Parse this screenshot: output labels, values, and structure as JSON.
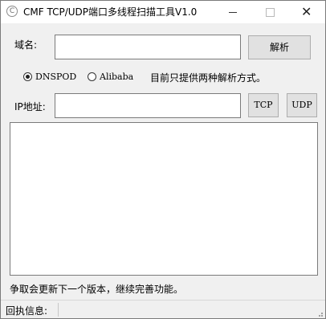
{
  "window": {
    "title": "CMF TCP/UDP端口多线程扫描工具V1.0",
    "app_icon": "C",
    "controls": {
      "minimize": "minimize-icon",
      "maximize": "maximize-icon",
      "close": "close-icon"
    }
  },
  "domain": {
    "label": "域名:",
    "value": "",
    "button": "解析"
  },
  "radios": {
    "options": [
      {
        "label": "DNSPOD",
        "selected": true
      },
      {
        "label": "Alibaba",
        "selected": false
      }
    ],
    "note": "目前只提供两种解析方式。"
  },
  "ip": {
    "label": "IP地址:",
    "value": "",
    "tcp_button": "TCP",
    "udp_button": "UDP"
  },
  "output": {
    "text": ""
  },
  "footer_note": "争取会更新下一个版本，继续完善功能。",
  "status": {
    "label": "回执信息:",
    "value": ""
  }
}
